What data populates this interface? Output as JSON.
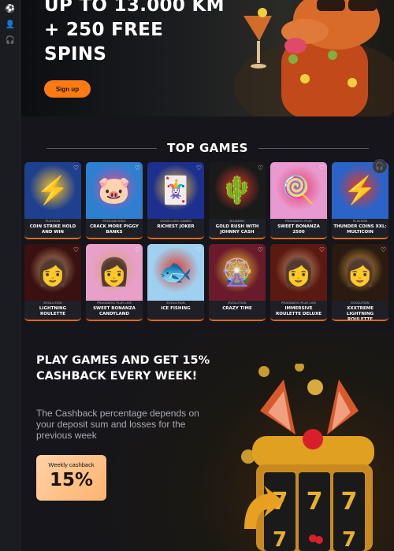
{
  "sidebar": {
    "icons": [
      "sports-icon",
      "user-icon",
      "headset-icon"
    ]
  },
  "hero": {
    "title": "UP TO 13.000 KM\n+ 250 FREE\nSPINS",
    "signup_label": "Sign up"
  },
  "top_games": {
    "heading": "TOP GAMES",
    "games": [
      {
        "provider": "PLAYSON",
        "name": "COIN STRIKE HOLD AND WIN",
        "icon": "lightning-coin-icon",
        "bg": "#1f3f8f",
        "accent": "#f2c230"
      },
      {
        "provider": "PENGUIN KING",
        "name": "CRACK MORE PIGGY BANKS",
        "icon": "piggy-icon",
        "bg": "#2f7fd0",
        "accent": "#e04aa0"
      },
      {
        "provider": "GOOD LUCK GAMES",
        "name": "RICHEST JOKER",
        "icon": "joker-icon",
        "bg": "#1d2f8f",
        "accent": "#f2c230"
      },
      {
        "provider": "BGAMING",
        "name": "GOLD RUSH WITH JOHNNY CASH",
        "icon": "cactus-wild-icon",
        "bg": "#1a1a1a",
        "accent": "#d83a2a"
      },
      {
        "provider": "PRAGMATIC PLAY",
        "name": "SWEET BONANZA 2500",
        "icon": "lollipop-icon",
        "bg": "#e89ad0",
        "accent": "#e83a6a"
      },
      {
        "provider": "PLAYSON",
        "name": "THUNDER COINS XXL: MULTICOIN",
        "icon": "lightning-coin-icon",
        "bg": "#2b63c8",
        "accent": "#e8392a"
      },
      {
        "provider": "EVOLUTION",
        "name": "LIGHTNING ROULETTE",
        "icon": "dealer-icon",
        "bg": "#3a1010",
        "accent": "#d0a070"
      },
      {
        "provider": "PRAGMATIC PLAY LIVE",
        "name": "SWEET BONANZA CANDYLAND",
        "icon": "dealer-icon",
        "bg": "#e8a0c8",
        "accent": "#d0a070"
      },
      {
        "provider": "EVOLUTION",
        "name": "ICE FISHING",
        "icon": "fish-icon",
        "bg": "#9fd0f0",
        "accent": "#e23a2a"
      },
      {
        "provider": "EVOLUTION",
        "name": "CRAZY TIME",
        "icon": "wheel-icon",
        "bg": "#6a1a2a",
        "accent": "#f2c230"
      },
      {
        "provider": "PRAGMATIC PLAY LIVE",
        "name": "IMMERSIVE ROULETTE DELUXE",
        "icon": "dealer-icon",
        "bg": "#5a1a12",
        "accent": "#d0a070"
      },
      {
        "provider": "EVOLUTION",
        "name": "XXXTREME LIGHTNING ROULETTE",
        "icon": "dealer-icon",
        "bg": "#2a1a10",
        "accent": "#e0a040"
      }
    ]
  },
  "promo": {
    "title": "PLAY GAMES AND GET 15% CASHBACK EVERY WEEK!",
    "description": "The Cashback percentage depends on your deposit sum and losses for the previous week",
    "cashback_label": "Weekly cashback",
    "cashback_value": "15%"
  }
}
